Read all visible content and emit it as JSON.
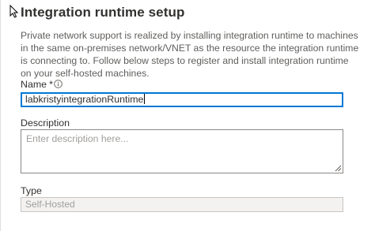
{
  "setup": {
    "title": "Integration runtime setup",
    "description": "Private network support is realized by installing integration runtime to machines in the same on-premises network/VNET as the resource the integration runtime is connecting to. Follow below steps to register and install integration runtime on your self-hosted machines."
  },
  "fields": {
    "name": {
      "label": "Name",
      "required_marker": "*",
      "value": "labkristyintegrationRuntime"
    },
    "description": {
      "label": "Description",
      "placeholder": "Enter description here..."
    },
    "type": {
      "label": "Type",
      "value": "Self-Hosted"
    }
  },
  "icons": {
    "cursor": "mouse-pointer-icon",
    "info": "info-icon",
    "resize": "resize-grip-icon"
  },
  "colors": {
    "focus_border": "#0078d4",
    "input_border": "#8a8886",
    "disabled_background": "#f3f2f1",
    "placeholder_text": "#a19f9d"
  }
}
